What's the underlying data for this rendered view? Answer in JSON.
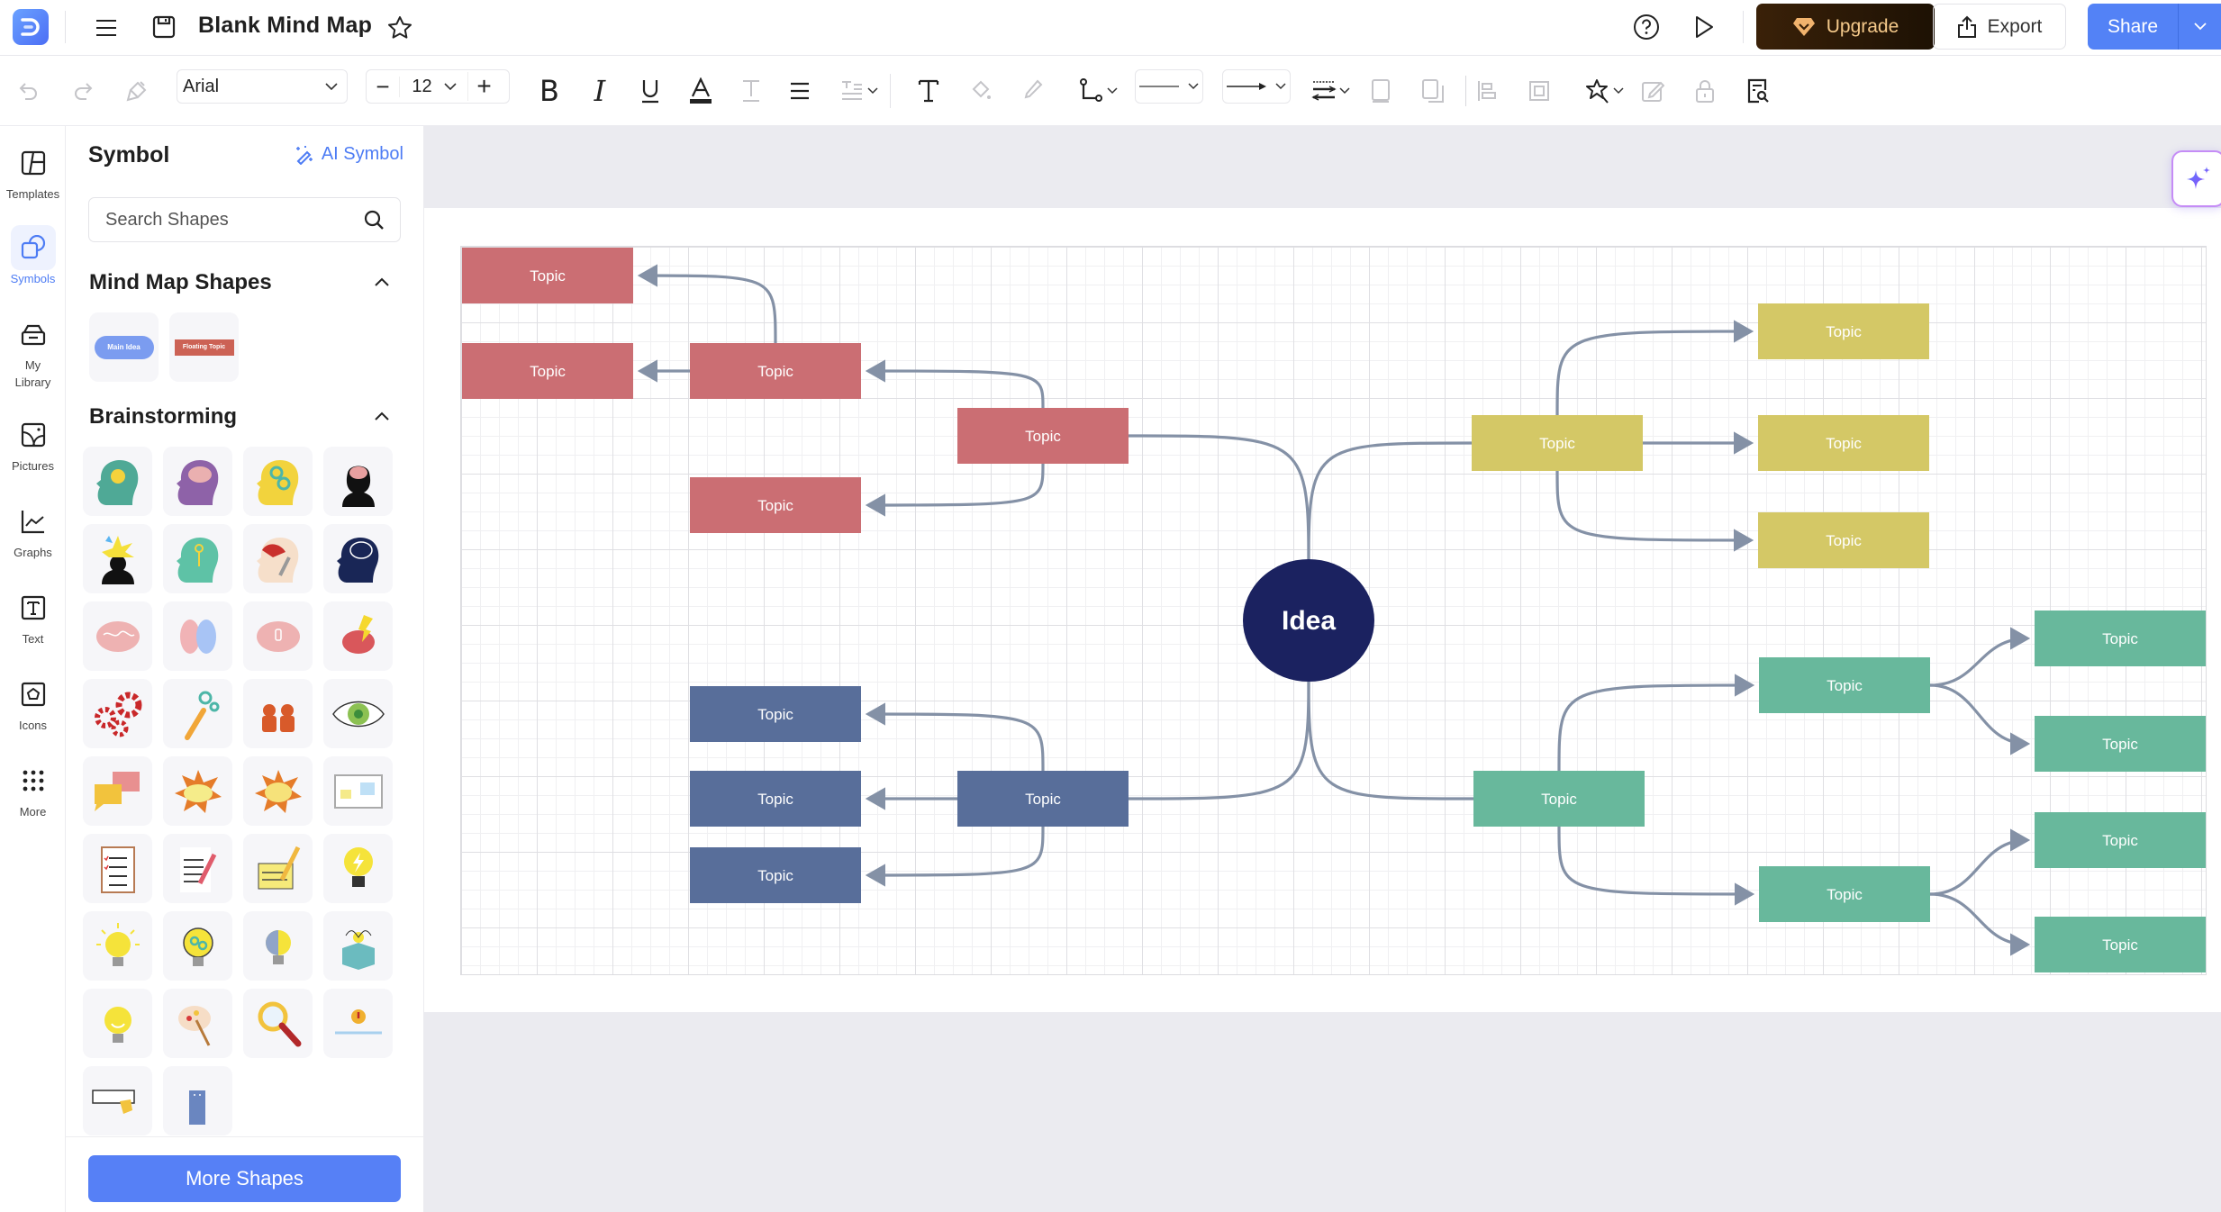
{
  "app": {
    "title": "Blank Mind Map",
    "logo": "edrawmind-logo"
  },
  "topbar": {
    "menu_icon": "hamburger-icon",
    "save_icon": "save-icon",
    "favorite_icon": "star-icon",
    "help_icon": "help-icon",
    "present_icon": "play-icon",
    "upgrade_label": "Upgrade",
    "export_label": "Export",
    "share_label": "Share"
  },
  "toolbar": {
    "font_family": "Arial",
    "font_size": "12",
    "tools": [
      "undo",
      "redo",
      "format-painter",
      "bold",
      "italic",
      "underline",
      "font-color",
      "text-style",
      "align",
      "spacing",
      "text",
      "fill",
      "line-color",
      "connector",
      "line-style",
      "arrow-style",
      "line-weight",
      "bring-front",
      "send-back",
      "align-objects",
      "group",
      "smart-style",
      "edit",
      "lock",
      "find-replace"
    ]
  },
  "rail": {
    "items": [
      {
        "label": "Templates",
        "icon": "templates-icon",
        "active": false
      },
      {
        "label": "Symbols",
        "icon": "symbols-icon",
        "active": true
      },
      {
        "label": "My Library",
        "icon": "library-icon",
        "active": false
      },
      {
        "label": "Pictures",
        "icon": "pictures-icon",
        "active": false
      },
      {
        "label": "Graphs",
        "icon": "graphs-icon",
        "active": false
      },
      {
        "label": "Text",
        "icon": "text-icon",
        "active": false
      },
      {
        "label": "Icons",
        "icon": "icons-icon",
        "active": false
      },
      {
        "label": "More",
        "icon": "more-icon",
        "active": false
      }
    ]
  },
  "panel": {
    "title": "Symbol",
    "ai_symbol_label": "AI Symbol",
    "search_placeholder": "Search Shapes",
    "sections": [
      {
        "title": "Mind Map Shapes",
        "expanded": true,
        "items": [
          {
            "label": "Main Idea",
            "color": "#7b9cf0"
          },
          {
            "label": "Floating Topic",
            "color": "#cc6255"
          }
        ]
      },
      {
        "title": "Brainstorming",
        "expanded": true,
        "items": [
          "head-lightbulb",
          "head-brain-purple",
          "head-gears-yellow",
          "head-brain-black",
          "head-explosion",
          "head-key",
          "head-puzzle",
          "head-brain-navy",
          "brain-pink",
          "brain-halves",
          "brain-lightbulb",
          "brain-lightning",
          "gears-red",
          "wrench-gears",
          "people-talking",
          "eye-target",
          "speech-bubbles",
          "explosion-lightbulb",
          "explosion-yellow",
          "whiteboard-notes",
          "clipboard-checklist",
          "document-pencil",
          "notepad-pencil",
          "lightbulb-lightning",
          "lightbulb-glowing",
          "lightbulb-gears",
          "lightbulb-brain",
          "box-lightbulb",
          "lightbulb-smile",
          "paint-palette",
          "magnifying-glass",
          "book-exclamation",
          "sign-hand",
          "phone-blue"
        ]
      }
    ],
    "more_shapes_label": "More Shapes"
  },
  "mindmap": {
    "connector_color": "#8491a6",
    "center": {
      "label": "Idea",
      "color": "#1b2260"
    },
    "branches": [
      {
        "name": "red",
        "color": "#cb6e73",
        "side": "left",
        "main": {
          "label": "Topic"
        },
        "children": [
          {
            "label": "Topic",
            "children": [
              {
                "label": "Topic"
              },
              {
                "label": "Topic"
              }
            ]
          },
          {
            "label": "Topic",
            "children": []
          }
        ]
      },
      {
        "name": "yellow",
        "color": "#d4c866",
        "side": "right",
        "main": {
          "label": "Topic"
        },
        "children": [
          {
            "label": "Topic"
          },
          {
            "label": "Topic"
          },
          {
            "label": "Topic"
          }
        ]
      },
      {
        "name": "blue",
        "color": "#586e9a",
        "side": "left",
        "main": {
          "label": "Topic"
        },
        "children": [
          {
            "label": "Topic"
          },
          {
            "label": "Topic"
          },
          {
            "label": "Topic"
          }
        ]
      },
      {
        "name": "green",
        "color": "#68b89c",
        "side": "right",
        "main": {
          "label": "Topic"
        },
        "children": [
          {
            "label": "Topic",
            "children": [
              {
                "label": "Topic"
              },
              {
                "label": "Topic"
              }
            ]
          },
          {
            "label": "Topic",
            "children": [
              {
                "label": "Topic"
              },
              {
                "label": "Topic"
              }
            ]
          }
        ]
      }
    ]
  }
}
